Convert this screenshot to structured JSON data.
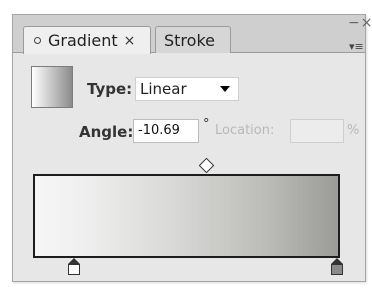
{
  "window": {
    "close_label": "−×"
  },
  "tabs": [
    {
      "label": "Gradient",
      "close": "×",
      "active": true
    },
    {
      "label": "Stroke",
      "active": false
    }
  ],
  "panel_menu": {
    "icon": "▾≡"
  },
  "type": {
    "label": "Type:",
    "value": "Linear"
  },
  "angle": {
    "label": "Angle:",
    "value": "-10.69",
    "icon": "°"
  },
  "location": {
    "label": "Location:",
    "value": "",
    "unit": "%"
  },
  "gradient": {
    "start_color": "#ffffff",
    "end_color": "#8a8a86",
    "midpoint_fraction": 0.5
  },
  "colors": {
    "panel_bg": "#e7e7e7",
    "tabbar_bg": "#cfcfcf",
    "ramp_border": "#1d1d1d"
  }
}
